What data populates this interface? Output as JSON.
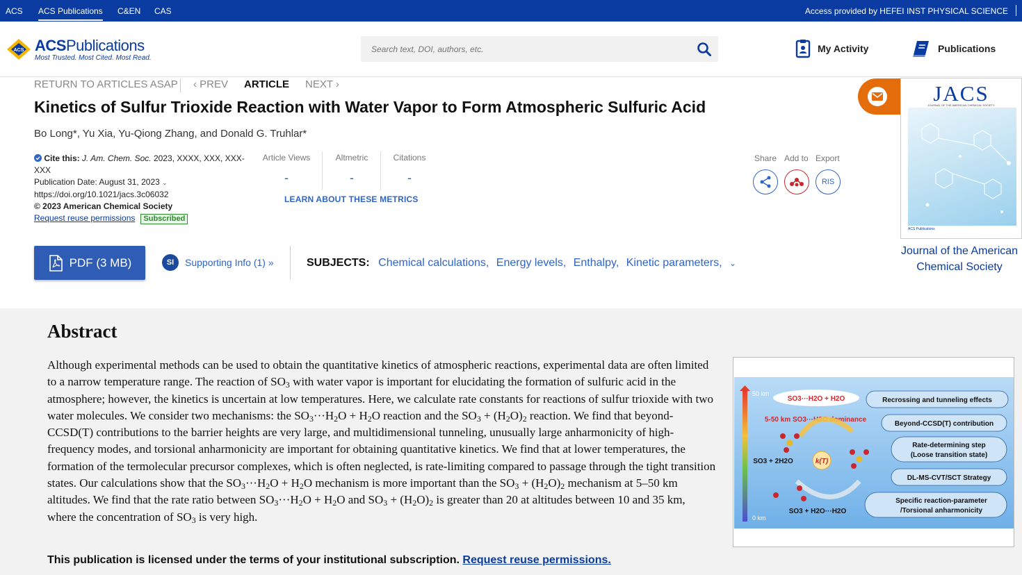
{
  "topbar": {
    "links": [
      "ACS",
      "ACS Publications",
      "C&EN",
      "CAS"
    ],
    "access": "Access provided by HEFEI INST PHYSICAL SCIENCE"
  },
  "header": {
    "logo_main": "ACS",
    "logo_rest": "Publications",
    "logo_tagline": "Most Trusted. Most Cited. Most Read.",
    "search_placeholder": "Search text, DOI, authors, etc.",
    "my_activity": "My Activity",
    "publications": "Publications"
  },
  "artnav": {
    "return": "RETURN TO ARTICLES ASAP",
    "prev": "PREV",
    "current": "ARTICLE",
    "next": "NEXT"
  },
  "article": {
    "title": "Kinetics of Sulfur Trioxide Reaction with Water Vapor to Form Atmospheric Sulfuric Acid",
    "authors": "Bo Long*, Yu Xia, Yu-Qiong Zhang, and Donald G. Truhlar*"
  },
  "cite": {
    "label": "Cite this:",
    "journal": "J. Am. Chem. Soc.",
    "ref1": " 2023, XXXX, XXX, XXX-",
    "ref2": "XXX",
    "pubdate": "Publication Date: August 31, 2023",
    "doi": "https://doi.org/10.1021/jacs.3c06032",
    "copyright": "© 2023 American Chemical Society",
    "reuse": "Request reuse permissions",
    "badge": "Subscribed"
  },
  "metrics": {
    "items": [
      {
        "label": "Article Views",
        "value": "-"
      },
      {
        "label": "Altmetric",
        "value": "-"
      },
      {
        "label": "Citations",
        "value": "-"
      }
    ],
    "learn": "LEARN ABOUT THESE METRICS"
  },
  "share": {
    "share": "Share",
    "add_to": "Add to",
    "export": "Export",
    "ris": "RIS"
  },
  "journal": {
    "cover_title": "JACS",
    "cover_subtitle": "JOURNAL OF THE AMERICAN CHEMICAL SOCIETY",
    "cover_footer": "ACS Publications",
    "name_line1": "Journal of the American",
    "name_line2": "Chemical Society"
  },
  "actions": {
    "pdf": "PDF (3 MB)",
    "si_icon": "SI",
    "si": "Supporting Info (1) »",
    "subjects_label": "SUBJECTS:",
    "subjects": [
      "Chemical calculations",
      "Energy levels",
      "Enthalpy",
      "Kinetic parameters"
    ]
  },
  "abstract": {
    "heading": "Abstract",
    "p1": "Although experimental methods can be used to obtain the quantitative kinetics of atmospheric reactions, experimental data are often limited to a narrow temperature range. The reaction of SO",
    "p2": " with water vapor is important for elucidating the formation of sulfuric acid in the atmosphere; however, the kinetics is uncertain at low temperatures. Here, we calculate rate constants for reactions of sulfur trioxide with two water molecules. We consider two mechanisms: the SO",
    "p3": "···H",
    "p4": "O + H",
    "p5": "O reaction and the SO",
    "p6": " + (H",
    "p7": "O)",
    "p8": " reaction. We find that beyond-CCSD(T) contributions to the barrier heights are very large, and multidimensional tunneling, unusually large anharmonicity of high-frequency modes, and torsional anharmonicity are important for obtaining quantitative kinetics. We find that at lower temperatures, the formation of the termolecular precursor complexes, which is often neglected, is rate-limiting compared to passage through the tight transition states. Our calculations show that the SO",
    "p9": " mechanism is more important than the SO",
    "p10": " mechanism at 5–50 km altitudes. We find that the rate ratio between SO",
    "p11": "O and SO",
    "p12": " is greater than 20 at altitudes between 10 and 35 km, where the concentration of SO",
    "p13": " is very high.",
    "sub3": "3",
    "sub2": "2"
  },
  "license": {
    "text": "This publication is licensed under the terms of your institutional subscription.",
    "link": "Request reuse permissions."
  },
  "toc": {
    "alt_top": "50 km",
    "alt_bottom": "0 km",
    "top_complex": "SO3···H2O + H2O",
    "dominance": "5-50 km SO3···H2O dominance",
    "left_reactant": "SO3 + 2H2O",
    "kt": "k(T)",
    "bottom_complex": "SO3 + H2O···H2O",
    "boxes": [
      "Recrossing and tunneling effects",
      "Beyond-CCSD(T) contribution",
      "Rate-determining step",
      "(Loose transition state)",
      "DL-MS-CVT/SCT Strategy",
      "Specific reaction-parameter",
      "/Torsional anharmonicity"
    ]
  },
  "colors": {
    "acs_blue": "#0a3ba0",
    "link_blue": "#2f64c8",
    "mail_orange": "#e46c0a",
    "subscribed_green": "#2e8b2e"
  }
}
